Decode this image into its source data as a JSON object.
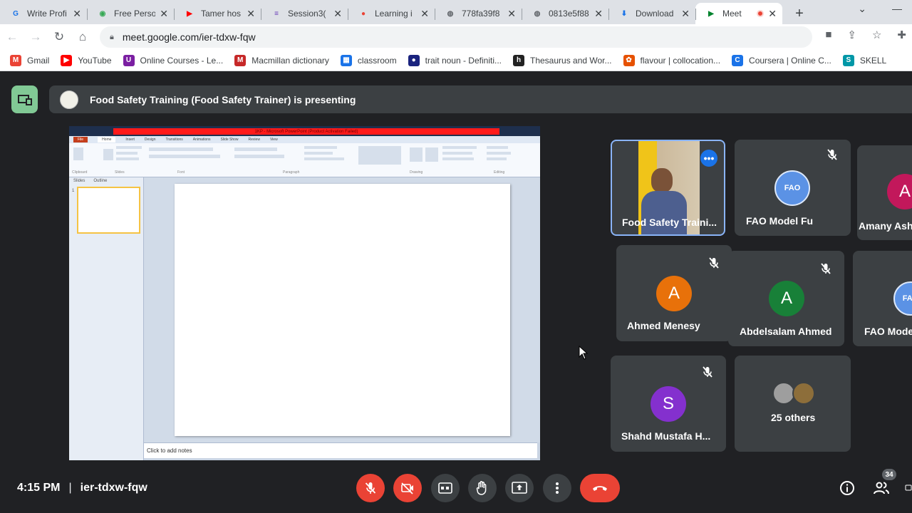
{
  "browser": {
    "tabs": [
      {
        "label": "Write Profi",
        "icon": "google-icon",
        "color": "#1a73e8",
        "glyph": "G"
      },
      {
        "label": "Free Perso",
        "icon": "colorful-icon",
        "color": "#34a853",
        "glyph": "◉"
      },
      {
        "label": "Tamer hos",
        "icon": "youtube-icon",
        "color": "#ff0000",
        "glyph": "▶"
      },
      {
        "label": "Session3(",
        "icon": "forms-icon",
        "color": "#673ab7",
        "glyph": "≡"
      },
      {
        "label": "Learning i",
        "icon": "location-icon",
        "color": "#ea4335",
        "glyph": "●"
      },
      {
        "label": "778fa39f8",
        "icon": "globe-icon",
        "color": "#5f6368",
        "glyph": "◍"
      },
      {
        "label": "0813e5f88",
        "icon": "globe-icon",
        "color": "#5f6368",
        "glyph": "◍"
      },
      {
        "label": "Download",
        "icon": "download-icon",
        "color": "#1a73e8",
        "glyph": "⬇"
      },
      {
        "label": "Meet",
        "icon": "meet-icon",
        "color": "#00832d",
        "glyph": "▶",
        "active": true
      }
    ],
    "url": "meet.google.com/ier-tdxw-fqw",
    "bookmarks": [
      {
        "label": "Gmail",
        "color": "#ea4335",
        "glyph": "M"
      },
      {
        "label": "YouTube",
        "color": "#ff0000",
        "glyph": "▶"
      },
      {
        "label": "Online Courses - Le...",
        "color": "#7b1fa2",
        "glyph": "U"
      },
      {
        "label": "Macmillan dictionary",
        "color": "#c62828",
        "glyph": "M"
      },
      {
        "label": "classroom",
        "color": "#1a73e8",
        "glyph": "▦"
      },
      {
        "label": "trait noun - Definiti...",
        "color": "#1a237e",
        "glyph": "●"
      },
      {
        "label": "Thesaurus and Wor...",
        "color": "#222222",
        "glyph": "h"
      },
      {
        "label": "flavour | collocation...",
        "color": "#e65100",
        "glyph": "✿"
      },
      {
        "label": "Coursera | Online C...",
        "color": "#1a73e8",
        "glyph": "C"
      },
      {
        "label": "SKELL",
        "color": "#0097a7",
        "glyph": "S"
      }
    ]
  },
  "meet": {
    "presenting_banner": "Food Safety Training (Food Safety Trainer) is presenting",
    "shared_screen": {
      "title_text": "1KP - Microsoft PowerPoint (Product Activation Failed)",
      "ribbon_tabs": [
        "File",
        "Home",
        "Insert",
        "Design",
        "Transitions",
        "Animations",
        "Slide Show",
        "Review",
        "View"
      ],
      "ribbon_groups": [
        "Clipboard",
        "Slides",
        "Font",
        "Paragraph",
        "Drawing",
        "Editing"
      ],
      "panel_tabs": [
        "Slides",
        "Outline"
      ],
      "notes_placeholder": "Click to add notes",
      "thumb_number": "1"
    },
    "participants": [
      {
        "name": "Food Safety Traini...",
        "type": "video",
        "speaking": true
      },
      {
        "name": "FAO Model Fu",
        "type": "logo",
        "logo_text": "FAO",
        "muted": true
      },
      {
        "name": "Amany Ash",
        "type": "avatar",
        "initial": "A",
        "color": "#c2185b"
      },
      {
        "name": "Ahmed Menesy",
        "type": "avatar",
        "initial": "A",
        "color": "#e8710a",
        "muted": true
      },
      {
        "name": "Abdelsalam Ahmed",
        "type": "avatar",
        "initial": "A",
        "color": "#188038",
        "muted": true
      },
      {
        "name": "FAO Mode",
        "type": "logo",
        "logo_text": "FAO"
      },
      {
        "name": "Shahd Mustafa H...",
        "type": "avatar",
        "initial": "S",
        "color": "#8430ce",
        "muted": true
      },
      {
        "name": "25 others",
        "type": "others"
      }
    ]
  },
  "bottom": {
    "time": "4:15 PM",
    "meeting_code": "ier-tdxw-fqw",
    "people_count": "34"
  }
}
